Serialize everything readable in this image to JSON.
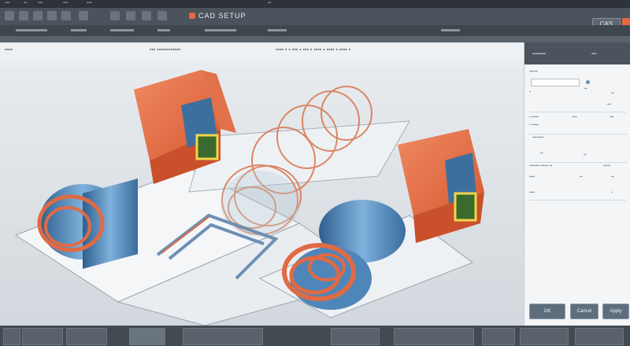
{
  "app": {
    "toolbar_title": "CAD SETUP",
    "top_right_button": "CAS"
  },
  "panel": {
    "buttons": [
      "OK",
      "Cancel",
      "Apply"
    ]
  },
  "colors": {
    "accent": "#e8693d",
    "part_blue": "#4f86b9",
    "toolbar": "#4b545c"
  }
}
